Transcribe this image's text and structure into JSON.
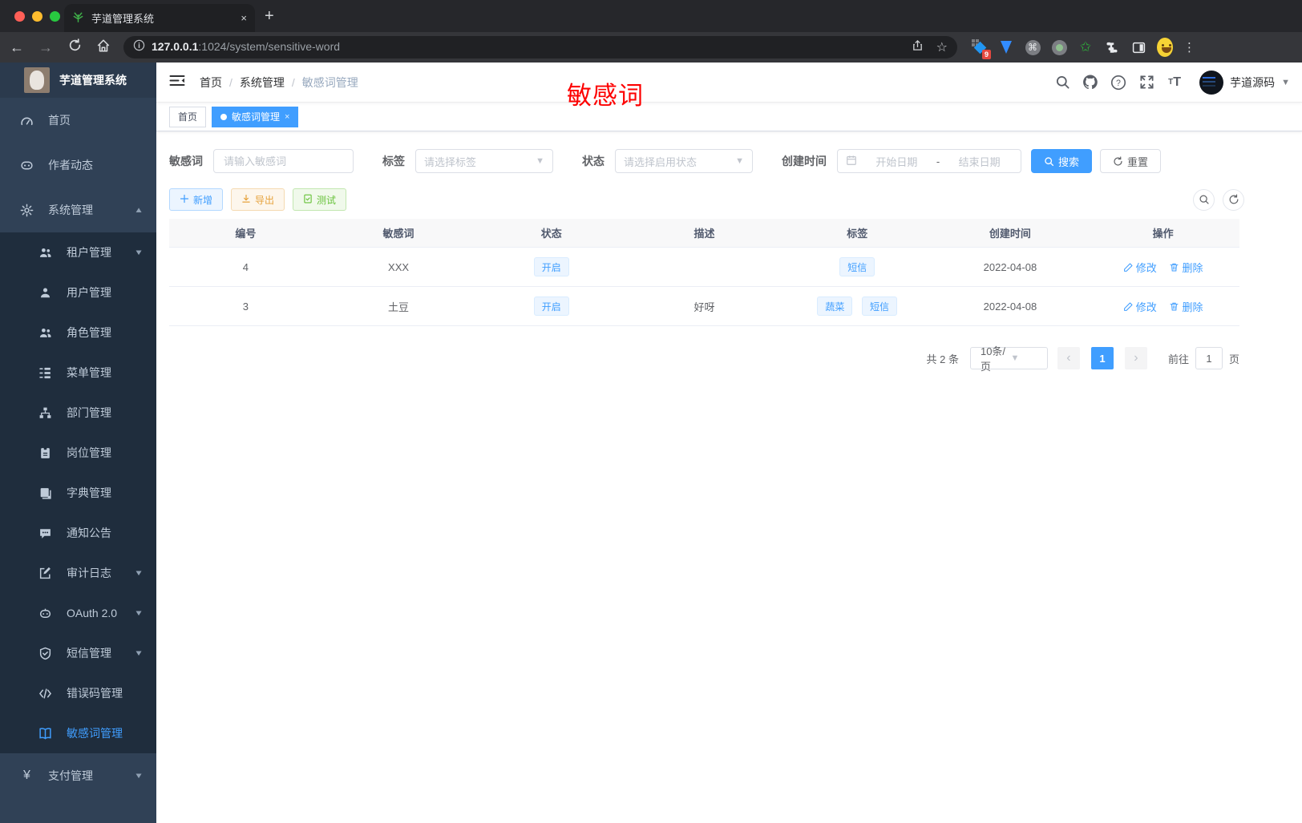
{
  "browser": {
    "tab_title": "芋道管理系统",
    "close_tab": "×",
    "new_tab": "+",
    "url_host": "127.0.0.1",
    "url_rest": ":1024/system/sensitive-word",
    "ext_badge": "9"
  },
  "sidebar": {
    "app_title": "芋道管理系统",
    "items": [
      {
        "label": "首页",
        "icon": "dashboard-icon"
      },
      {
        "label": "作者动态",
        "icon": "author-chat-icon"
      },
      {
        "label": "系统管理",
        "icon": "gear-icon",
        "arrow": "▲"
      },
      {
        "label": "租户管理",
        "icon": "tenant-users-icon",
        "arrow": "▼"
      },
      {
        "label": "用户管理",
        "icon": "user-icon"
      },
      {
        "label": "角色管理",
        "icon": "role-users-icon"
      },
      {
        "label": "菜单管理",
        "icon": "menu-tree-icon"
      },
      {
        "label": "部门管理",
        "icon": "org-chart-icon"
      },
      {
        "label": "岗位管理",
        "icon": "post-badge-icon"
      },
      {
        "label": "字典管理",
        "icon": "dictionary-icon"
      },
      {
        "label": "通知公告",
        "icon": "announcement-icon"
      },
      {
        "label": "审计日志",
        "icon": "audit-log-icon",
        "arrow": "▼"
      },
      {
        "label": "OAuth 2.0",
        "icon": "oauth-icon",
        "arrow": "▼"
      },
      {
        "label": "短信管理",
        "icon": "sms-shield-icon",
        "arrow": "▼"
      },
      {
        "label": "错误码管理",
        "icon": "error-code-icon"
      },
      {
        "label": "敏感词管理",
        "icon": "sensitive-word-book-icon"
      },
      {
        "label": "支付管理",
        "icon": "payment-yen-icon",
        "arrow": "▼"
      }
    ]
  },
  "header": {
    "breadcrumb": [
      "首页",
      "系统管理",
      "敏感词管理"
    ],
    "breadcrumb_sep": "/",
    "username": "芋道源码"
  },
  "annotation": "敏感词",
  "tags_view": {
    "tabs": [
      {
        "label": "首页"
      },
      {
        "label": "敏感词管理",
        "close": "×"
      }
    ]
  },
  "filters": {
    "word": {
      "label": "敏感词",
      "placeholder": "请输入敏感词"
    },
    "tag": {
      "label": "标签",
      "placeholder": "请选择标签"
    },
    "status": {
      "label": "状态",
      "placeholder": "请选择启用状态"
    },
    "create_time": {
      "label": "创建时间",
      "start_placeholder": "开始日期",
      "separator": "-",
      "end_placeholder": "结束日期"
    },
    "search_label": "搜索",
    "reset_label": "重置"
  },
  "toolbar": {
    "add_label": "新增",
    "export_label": "导出",
    "test_label": "测试"
  },
  "table": {
    "columns": [
      "编号",
      "敏感词",
      "状态",
      "描述",
      "标签",
      "创建时间",
      "操作"
    ],
    "rows": [
      {
        "id": "4",
        "word": "XXX",
        "status": "开启",
        "description": "",
        "tags": [
          "短信"
        ],
        "created": "2022-04-08"
      },
      {
        "id": "3",
        "word": "土豆",
        "status": "开启",
        "description": "好呀",
        "tags": [
          "蔬菜",
          "短信"
        ],
        "created": "2022-04-08"
      }
    ],
    "actions": {
      "edit": "修改",
      "delete": "删除"
    }
  },
  "pagination": {
    "total": "共 2 条",
    "page_size": "10条/页",
    "prev": "‹",
    "current": "1",
    "next": "›",
    "goto_label": "前往",
    "goto_value": "1",
    "unit": "页"
  },
  "colors": {
    "primary": "#409eff",
    "warning": "#e6a23c",
    "success": "#67c23a",
    "sidebar_bg": "#304156",
    "submenu_bg": "#1f2d3d",
    "annotation_red": "#fd0000"
  }
}
